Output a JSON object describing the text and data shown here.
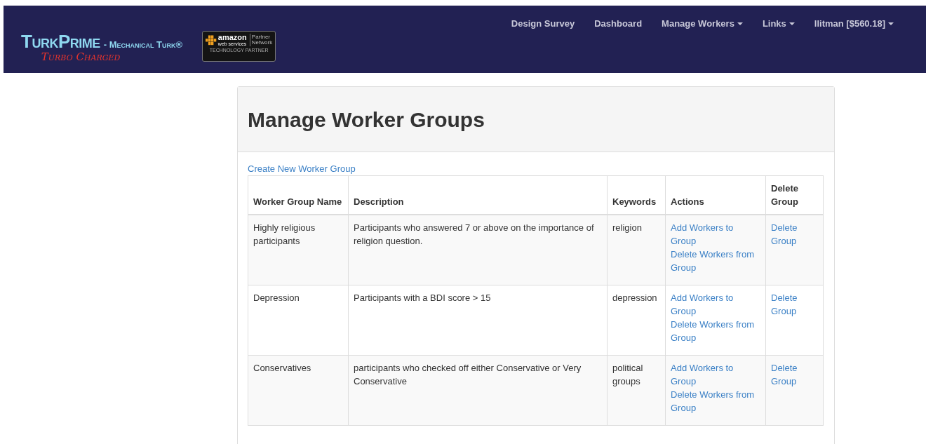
{
  "navbar": {
    "logo": {
      "title": "TurkPrime",
      "subtitle": "- Mechanical Turk®",
      "tagline": "Turbo Charged"
    },
    "partner_badge": {
      "brand": "amazon",
      "service": "web services",
      "partner": "Partner",
      "network": "Network",
      "caption": "TECHNOLOGY PARTNER"
    },
    "links": [
      {
        "label": "Design Survey",
        "dropdown": false
      },
      {
        "label": "Dashboard",
        "dropdown": false
      },
      {
        "label": "Manage Workers",
        "dropdown": true
      },
      {
        "label": "Links",
        "dropdown": true
      },
      {
        "label": "llitman [$560.18]",
        "dropdown": true
      }
    ]
  },
  "panel": {
    "title": "Manage Worker Groups",
    "create_link": "Create New Worker Group",
    "table": {
      "columns": [
        "Worker Group Name",
        "Description",
        "Keywords",
        "Actions",
        "Delete Group"
      ],
      "rows": [
        {
          "name": "Highly religious participants",
          "description": "Participants who answered 7 or above on the importance of religion question.",
          "keywords": "religion",
          "actions": [
            "Add Workers to Group",
            "Delete Workers from Group"
          ],
          "delete": "Delete Group"
        },
        {
          "name": "Depression",
          "description": "Participants with a BDI score > 15",
          "keywords": "depression",
          "actions": [
            "Add Workers to Group",
            "Delete Workers from Group"
          ],
          "delete": "Delete Group"
        },
        {
          "name": "Conservatives",
          "description": "participants who checked off either Conservative or Very Conservative",
          "keywords": "political groups",
          "actions": [
            "Add Workers to Group",
            "Delete Workers from Group"
          ],
          "delete": "Delete Group"
        }
      ]
    }
  }
}
